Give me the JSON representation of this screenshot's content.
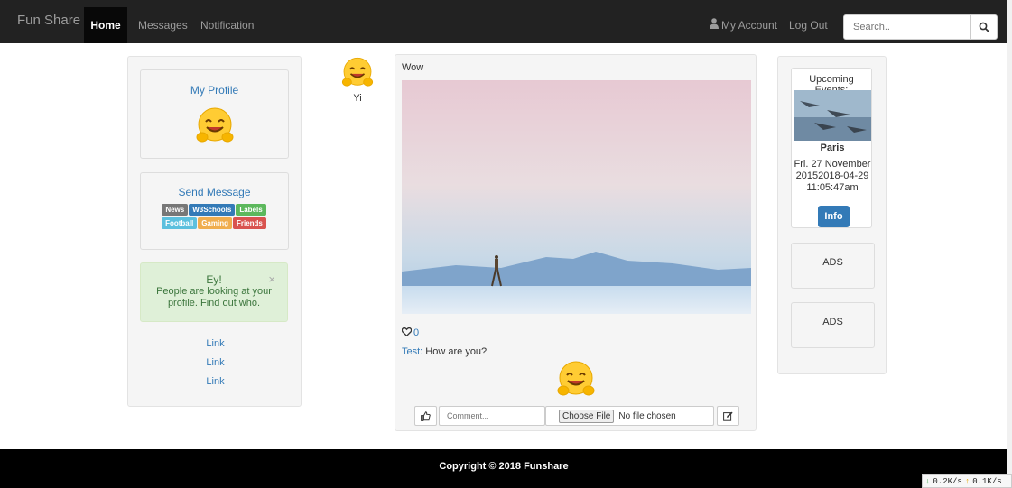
{
  "navbar": {
    "brand": "Fun Share",
    "items": [
      {
        "label": "Home",
        "active": true
      },
      {
        "label": "Messages",
        "active": false
      },
      {
        "label": "Notification",
        "active": false
      }
    ],
    "account": "My Account",
    "logout": "Log Out",
    "search_placeholder": "Search.."
  },
  "sidebar_left": {
    "profile_title": "My Profile",
    "send_message": "Send Message",
    "labels": [
      {
        "text": "News",
        "color": "#777777"
      },
      {
        "text": "W3Schools",
        "color": "#337ab7"
      },
      {
        "text": "Labels",
        "color": "#5cb85c"
      },
      {
        "text": "Football",
        "color": "#5bc0de"
      },
      {
        "text": "Gaming",
        "color": "#f0ad4e"
      },
      {
        "text": "Friends",
        "color": "#d9534f"
      }
    ],
    "alert": {
      "title": "Ey!",
      "text": "People are looking at your profile. Find out who.",
      "close": "×"
    },
    "links": [
      "Link",
      "Link",
      "Link"
    ]
  },
  "post": {
    "author": "Yi",
    "title": "Wow",
    "likes": "0",
    "comment_author": "Test:",
    "comment_text": "How are you?",
    "comment_placeholder": "Comment...",
    "choose_file": "Choose File",
    "no_file": "No file chosen"
  },
  "sidebar_right": {
    "events_title": "Upcoming Events:",
    "event_name": "Paris",
    "event_date": "Fri. 27 November 20152018-04-29 11:05:47am",
    "info_button": "Info",
    "ads": [
      "ADS",
      "ADS"
    ]
  },
  "footer": {
    "copyright": "Copyright © 2018 Funshare"
  },
  "netspeed": {
    "down": "0.2K/s",
    "up": "0.1K/s"
  }
}
